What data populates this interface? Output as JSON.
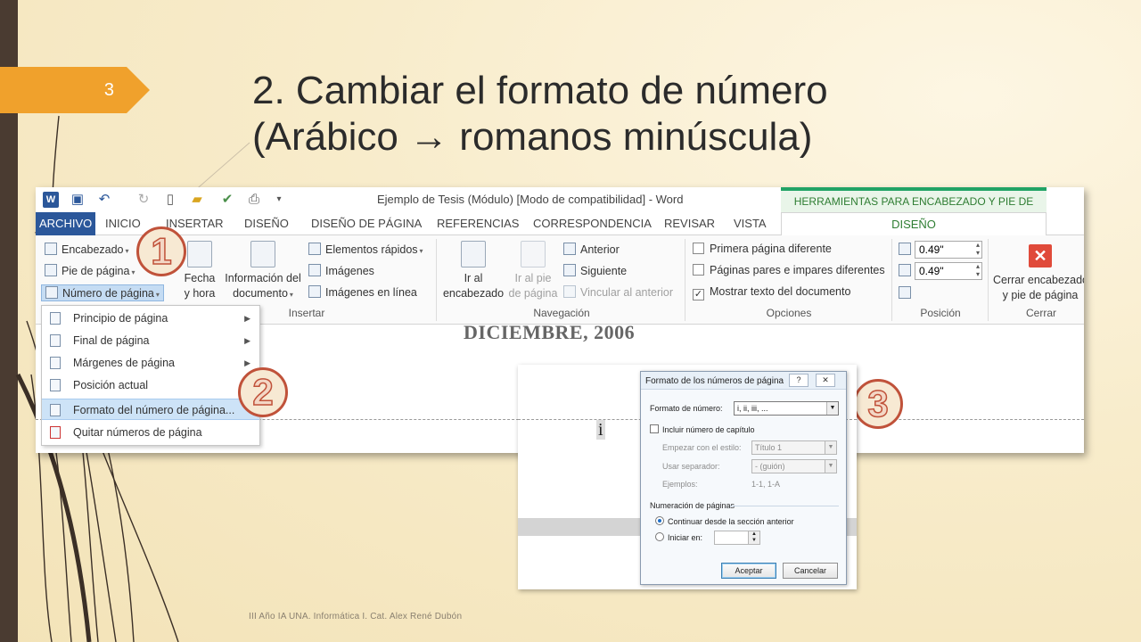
{
  "slide": {
    "number": "3",
    "title_line1": "2. Cambiar el formato de número",
    "title_line2": "(Arábico → romanos minúscula)",
    "footer": "III Año IA UNA. Informática I. Cat. Alex René Dubón"
  },
  "word": {
    "window_title": "Ejemplo de Tesis (Módulo) [Modo de compatibilidad] - Word",
    "contextual_tools": "HERRAMIENTAS PARA ENCABEZADO Y PIE DE PÁGINA",
    "tabs": [
      "ARCHIVO",
      "INICIO",
      "INSERTAR",
      "DISEÑO",
      "DISEÑO DE PÁGINA",
      "REFERENCIAS",
      "CORRESPONDENCIA",
      "REVISAR",
      "VISTA",
      "DISEÑO"
    ],
    "ribbon": {
      "header": "Encabezado",
      "footer": "Pie de página",
      "page_number": "Número de página",
      "date_time_1": "Fecha",
      "date_time_2": "y hora",
      "doc_info_1": "Información del",
      "doc_info_2": "documento",
      "quick_parts": "Elementos rápidos",
      "images": "Imágenes",
      "online_images": "Imágenes en línea",
      "group_insert": "Insertar",
      "goto_header_1": "Ir al",
      "goto_header_2": "encabezado",
      "goto_footer_1": "Ir al pie",
      "goto_footer_2": "de página",
      "previous": "Anterior",
      "next": "Siguiente",
      "link_previous": "Vincular al anterior",
      "group_nav": "Navegación",
      "first_page": "Primera página diferente",
      "odd_even": "Páginas pares e impares diferentes",
      "show_text": "Mostrar texto del documento",
      "group_options": "Opciones",
      "header_pos": "0.49\"",
      "footer_pos": "0.49\"",
      "group_position": "Posición",
      "close_1": "Cerrar encabezado",
      "close_2": "y pie de página",
      "group_close": "Cerrar"
    },
    "doc_heading": "DICIEMBRE, 2006",
    "menu": [
      "Principio de página",
      "Final de página",
      "Márgenes de página",
      "Posición actual",
      "Formato del número de página...",
      "Quitar números de página"
    ]
  },
  "steps": [
    "1",
    "2",
    "3"
  ],
  "dialog": {
    "title": "Formato de los números de página",
    "help": "?",
    "close": "✕",
    "format_label": "Formato de número:",
    "format_value": "i, ii, iii, ...",
    "include_chapter": "Incluir número de capítulo",
    "style_label": "Empezar con el estilo:",
    "style_value": "Título 1",
    "separator_label": "Usar separador:",
    "separator_value": "-    (guión)",
    "examples_label": "Ejemplos:",
    "examples_value": "1-1, 1-A",
    "numbering_header": "Numeración de páginas",
    "continue": "Continuar desde la sección anterior",
    "start_at": "Iniciar en:",
    "ok": "Aceptar",
    "cancel": "Cancelar"
  },
  "inset_numeral": "i",
  "colors": {
    "accent": "#f0a12c",
    "word_blue": "#2b579a",
    "contextual_green": "#21a366",
    "step_red": "#c0523a"
  }
}
